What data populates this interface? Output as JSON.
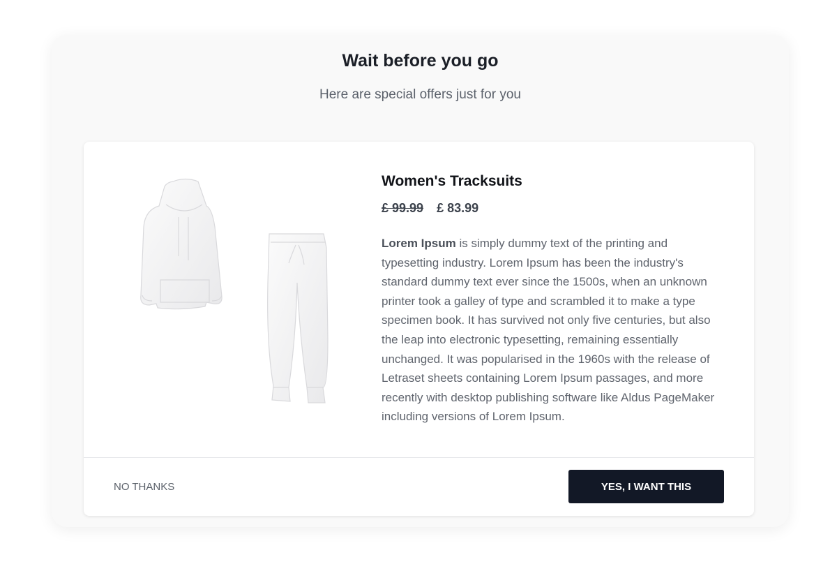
{
  "modal": {
    "title": "Wait before you go",
    "subtitle": "Here are special offers just for you"
  },
  "product": {
    "name": "Women's Tracksuits",
    "old_price": "£ 99.99",
    "new_price": "£ 83.99",
    "description_lead": "Lorem Ipsum",
    "description_body": " is simply dummy text of the printing and typesetting industry. Lorem Ipsum has been the industry's standard dummy text ever since the 1500s, when an unknown printer took a galley of type and scrambled it to make a type specimen book. It has survived not only five centuries, but also the leap into electronic typesetting, remaining essentially unchanged. It was popularised in the 1960s with the release of Letraset sheets containing Lorem Ipsum passages, and more recently with desktop publishing software like Aldus PageMaker including versions of Lorem Ipsum."
  },
  "actions": {
    "decline_label": "NO THANKS",
    "accept_label": "YES, I WANT THIS"
  },
  "colors": {
    "accent": "#121826",
    "modal_background": "#f9f9f9",
    "card_background": "#ffffff"
  }
}
